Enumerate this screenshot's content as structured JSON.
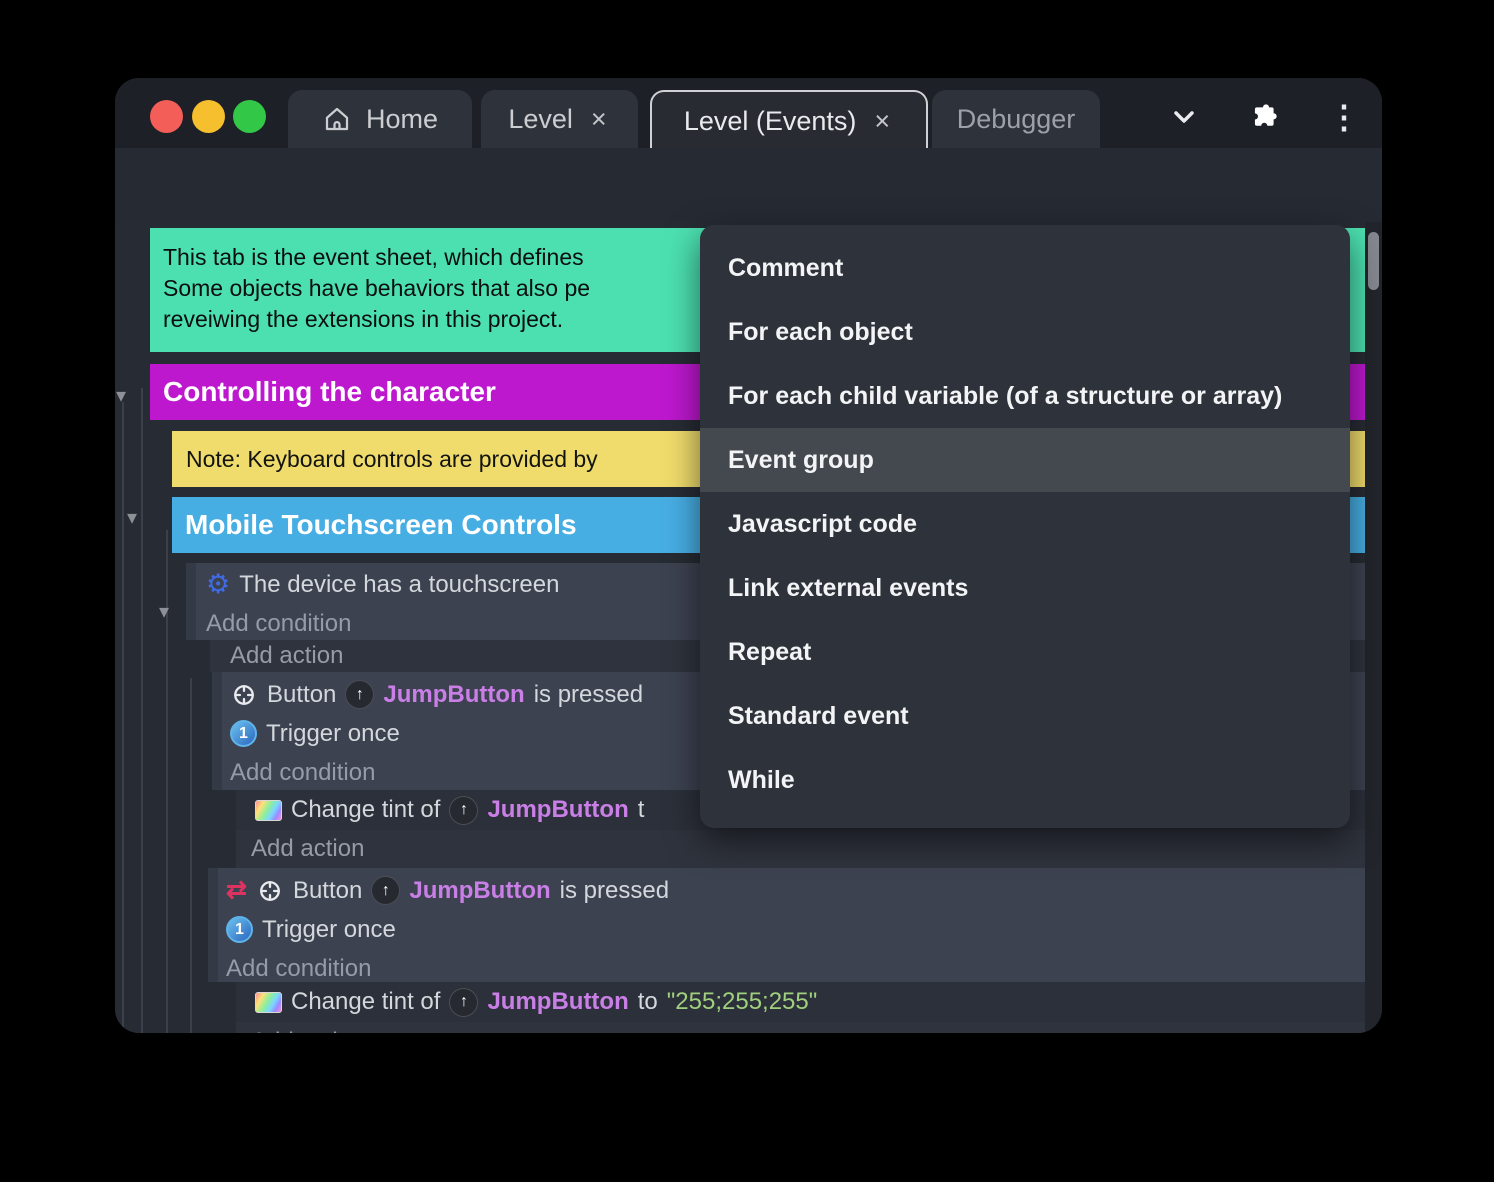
{
  "window": {
    "controls": [
      "close",
      "minimize",
      "zoom"
    ]
  },
  "tabs": {
    "home": "Home",
    "level": "Level",
    "level_events": "Level (Events)",
    "debugger": "Debugger"
  },
  "glyphs": {
    "close": "×",
    "dots": "⋮",
    "triangle": "▾",
    "gear": "⚙",
    "invert": "⇄",
    "arrow_up": "↑",
    "one": "1"
  },
  "menu": {
    "items": [
      "Comment",
      "For each object",
      "For each child variable (of a structure or array)",
      "Event group",
      "Javascript code",
      "Link external events",
      "Repeat",
      "Standard event",
      "While"
    ],
    "highlighted_item": "Event group"
  },
  "sheet": {
    "comment_line1": "This tab is the event sheet, which defines",
    "comment_line2": "Some objects have behaviors that also pe",
    "comment_line3": "reveiwing the extensions in this project.",
    "group_character": "Controlling the character",
    "note": "Note: Keyboard controls are provided by",
    "group_touch": "Mobile Touchscreen Controls",
    "device_condition": "The device has a touchscreen",
    "add_condition": "Add condition",
    "add_action": "Add action",
    "button_object": "Button",
    "jump_instance": "JumpButton",
    "pressed_suffix": "is pressed",
    "trigger_once": "Trigger once",
    "tint_prefix": "Change tint of",
    "tint_to": "to",
    "tint_truncated": "t",
    "tint_value": "\"255;255;255\""
  },
  "colors": {
    "accent_purple": "#5b3bd6",
    "comment_green": "#4ce0b0",
    "group_magenta": "#bd18ce",
    "note_yellow": "#f0dc6c",
    "group_blue": "#47aee4",
    "instance_purple": "#c97fe6",
    "string_green": "#a0cf7d",
    "menu_bg": "#2e323a",
    "menu_highlight": "#44484f",
    "event_bg": "#3d4250",
    "traffic_red": "#f35f58",
    "traffic_yellow": "#f6bf2e",
    "traffic_green": "#33c748"
  }
}
